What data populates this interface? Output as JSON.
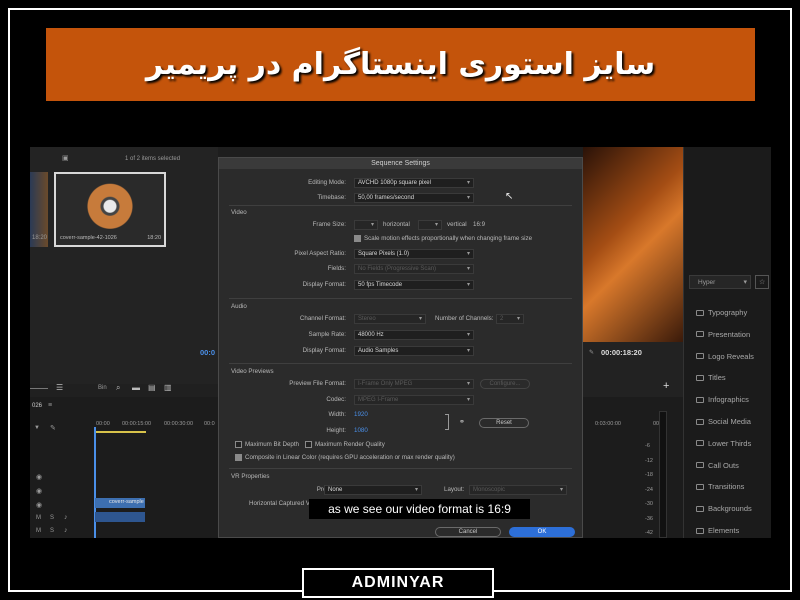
{
  "banner": {
    "title": "سایز استوری اینستاگرام در پریمیر"
  },
  "footer": {
    "brand": "ADMINYAR"
  },
  "caption": "as we see our video format is 16:9",
  "project_panel": {
    "items_selected": "1 of 2 items selected",
    "clip_name": "coverr-sample-42-1026",
    "clip_duration": "18:20",
    "left_clip_duration": "18:20",
    "bin_label": "Bin"
  },
  "program_monitor": {
    "timecode_left": "00:0",
    "timecode_right": "00:00:18:20"
  },
  "right_panel": {
    "search_label": "Hyper",
    "folders": [
      "Typography",
      "Presentation",
      "Logo Reveals",
      "Titles",
      "Infographics",
      "Social Media",
      "Lower Thirds",
      "Call Outs",
      "Transitions",
      "Backgrounds",
      "Elements"
    ]
  },
  "timeline": {
    "sequence_name": "026",
    "ruler": [
      "00:00",
      "00:00:15:00",
      "00:00:30:00",
      "00:0"
    ],
    "right_ruler": [
      "0:03:00:00",
      "00:0"
    ],
    "clip_label": "coverr-sample",
    "meter_ticks": [
      "-6",
      "-12",
      "-18",
      "-24",
      "-30",
      "-36",
      "-42"
    ]
  },
  "dialog": {
    "title": "Sequence Settings",
    "editing_mode_label": "Editing Mode:",
    "editing_mode_value": "AVCHD 1080p square pixel",
    "timebase_label": "Timebase:",
    "timebase_value": "50,00  frames/second",
    "video_section": "Video",
    "frame_size_label": "Frame Size:",
    "horizontal_label": "horizontal",
    "vertical_label": "vertical",
    "aspect_value": "16:9",
    "scale_motion_label": "Scale motion effects proportionally when changing frame size",
    "par_label": "Pixel Aspect Ratio:",
    "par_value": "Square Pixels (1.0)",
    "fields_label": "Fields:",
    "fields_value": "No Fields (Progressive Scan)",
    "display_format_label": "Display Format:",
    "display_format_value": "50 fps Timecode",
    "audio_section": "Audio",
    "channel_format_label": "Channel Format:",
    "channel_format_value": "Stereo",
    "num_channels_label": "Number of Channels:",
    "num_channels_value": "2",
    "sample_rate_label": "Sample Rate:",
    "sample_rate_value": "48000 Hz",
    "audio_display_label": "Display Format:",
    "audio_display_value": "Audio Samples",
    "previews_section": "Video Previews",
    "preview_format_label": "Preview File Format:",
    "preview_format_value": "I-Frame Only MPEG",
    "configure_label": "Configure...",
    "codec_label": "Codec:",
    "codec_value": "MPEG I-Frame",
    "width_label": "Width:",
    "width_value": "1920",
    "height_label": "Height:",
    "height_value": "1080",
    "reset_label": "Reset",
    "max_bit_depth_label": "Maximum Bit Depth",
    "max_render_label": "Maximum Render Quality",
    "composite_label": "Composite in Linear Color (requires GPU acceleration or max render quality)",
    "vr_section": "VR Properties",
    "projection_label": "Projection:",
    "projection_value": "None",
    "layout_label": "Layout:",
    "layout_value": "Monoscopic",
    "h_captured_label": "Horizontal Captured View:",
    "cancel_label": "Cancel",
    "ok_label": "OK"
  }
}
